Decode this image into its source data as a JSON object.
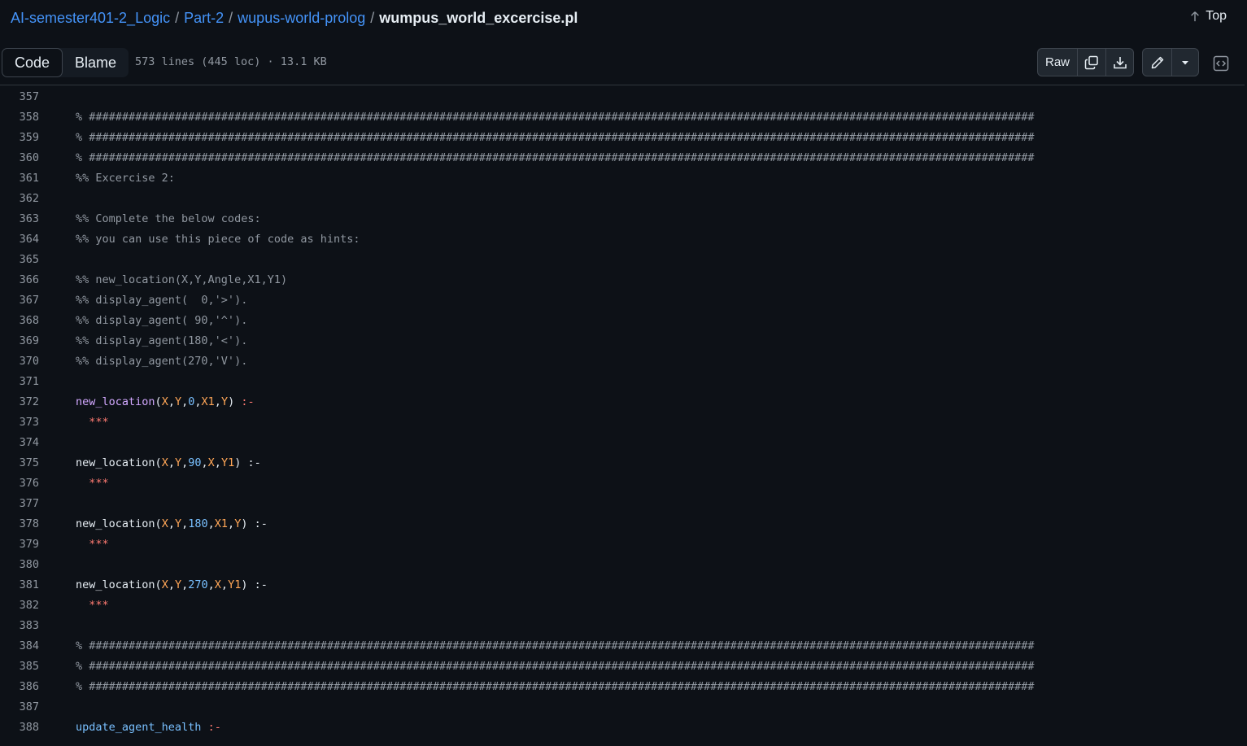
{
  "breadcrumb": {
    "repo": "AI-semester401-2_Logic",
    "folder1": "Part-2",
    "folder2": "wupus-world-prolog",
    "separator": "/",
    "file": "wumpus_world_excercise.pl"
  },
  "top_label": "Top",
  "tabs": {
    "code": "Code",
    "blame": "Blame"
  },
  "file_info": "573 lines (445 loc) · 13.1 KB",
  "toolbar": {
    "raw_label": "Raw",
    "icons": [
      "copy-icon",
      "download-icon",
      "pencil-icon",
      "triangle-down-icon",
      "code-square-icon"
    ]
  },
  "colors": {
    "background": "#0d1117",
    "link": "#4493f8",
    "comment": "#9198a1",
    "variable": "#ffa657",
    "number": "#79c0ff",
    "operator": "#ff7b72"
  },
  "lines": [
    {
      "n": "357",
      "tokens": []
    },
    {
      "n": "358",
      "tokens": [
        {
          "t": "% ###############################################################################################################################################",
          "c": "cmt"
        }
      ]
    },
    {
      "n": "359",
      "tokens": [
        {
          "t": "% ###############################################################################################################################################",
          "c": "cmt"
        }
      ]
    },
    {
      "n": "360",
      "tokens": [
        {
          "t": "% ###############################################################################################################################################",
          "c": "cmt"
        }
      ]
    },
    {
      "n": "361",
      "tokens": [
        {
          "t": "%% Excercise 2:",
          "c": "cmt"
        }
      ]
    },
    {
      "n": "362",
      "tokens": []
    },
    {
      "n": "363",
      "tokens": [
        {
          "t": "%% Complete the below codes:",
          "c": "cmt"
        }
      ]
    },
    {
      "n": "364",
      "tokens": [
        {
          "t": "%% you can use this piece of code as hints:",
          "c": "cmt"
        }
      ]
    },
    {
      "n": "365",
      "tokens": []
    },
    {
      "n": "366",
      "tokens": [
        {
          "t": "%% new_location(X,Y,Angle,X1,Y1)",
          "c": "cmt"
        }
      ]
    },
    {
      "n": "367",
      "tokens": [
        {
          "t": "%% display_agent(  0,'>').",
          "c": "cmt"
        }
      ]
    },
    {
      "n": "368",
      "tokens": [
        {
          "t": "%% display_agent( 90,'^').",
          "c": "cmt"
        }
      ]
    },
    {
      "n": "369",
      "tokens": [
        {
          "t": "%% display_agent(180,'<').",
          "c": "cmt"
        }
      ]
    },
    {
      "n": "370",
      "tokens": [
        {
          "t": "%% display_agent(270,'V').",
          "c": "cmt"
        }
      ]
    },
    {
      "n": "371",
      "tokens": []
    },
    {
      "n": "372",
      "tokens": [
        {
          "t": "new_location",
          "c": "fn"
        },
        {
          "t": "(",
          "c": "pun"
        },
        {
          "t": "X",
          "c": "var"
        },
        {
          "t": ",",
          "c": "pun"
        },
        {
          "t": "Y",
          "c": "var"
        },
        {
          "t": ",",
          "c": "pun"
        },
        {
          "t": "0",
          "c": "num"
        },
        {
          "t": ",",
          "c": "pun"
        },
        {
          "t": "X1",
          "c": "var"
        },
        {
          "t": ",",
          "c": "pun"
        },
        {
          "t": "Y",
          "c": "var"
        },
        {
          "t": ") ",
          "c": "pun"
        },
        {
          "t": ":-",
          "c": "op"
        }
      ]
    },
    {
      "n": "373",
      "tokens": [
        {
          "t": "  ***",
          "c": "op"
        }
      ]
    },
    {
      "n": "374",
      "tokens": []
    },
    {
      "n": "375",
      "tokens": [
        {
          "t": "new_location",
          "c": "fn2"
        },
        {
          "t": "(",
          "c": "pun"
        },
        {
          "t": "X",
          "c": "var"
        },
        {
          "t": ",",
          "c": "pun"
        },
        {
          "t": "Y",
          "c": "var"
        },
        {
          "t": ",",
          "c": "pun"
        },
        {
          "t": "90",
          "c": "num"
        },
        {
          "t": ",",
          "c": "pun"
        },
        {
          "t": "X",
          "c": "var"
        },
        {
          "t": ",",
          "c": "pun"
        },
        {
          "t": "Y1",
          "c": "var"
        },
        {
          "t": ") ",
          "c": "pun"
        },
        {
          "t": ":-",
          "c": "pun"
        }
      ]
    },
    {
      "n": "376",
      "tokens": [
        {
          "t": "  ***",
          "c": "op"
        }
      ]
    },
    {
      "n": "377",
      "tokens": []
    },
    {
      "n": "378",
      "tokens": [
        {
          "t": "new_location",
          "c": "fn2"
        },
        {
          "t": "(",
          "c": "pun"
        },
        {
          "t": "X",
          "c": "var"
        },
        {
          "t": ",",
          "c": "pun"
        },
        {
          "t": "Y",
          "c": "var"
        },
        {
          "t": ",",
          "c": "pun"
        },
        {
          "t": "180",
          "c": "num"
        },
        {
          "t": ",",
          "c": "pun"
        },
        {
          "t": "X1",
          "c": "var"
        },
        {
          "t": ",",
          "c": "pun"
        },
        {
          "t": "Y",
          "c": "var"
        },
        {
          "t": ") ",
          "c": "pun"
        },
        {
          "t": ":-",
          "c": "pun"
        }
      ]
    },
    {
      "n": "379",
      "tokens": [
        {
          "t": "  ***",
          "c": "op"
        }
      ]
    },
    {
      "n": "380",
      "tokens": []
    },
    {
      "n": "381",
      "tokens": [
        {
          "t": "new_location",
          "c": "fn2"
        },
        {
          "t": "(",
          "c": "pun"
        },
        {
          "t": "X",
          "c": "var"
        },
        {
          "t": ",",
          "c": "pun"
        },
        {
          "t": "Y",
          "c": "var"
        },
        {
          "t": ",",
          "c": "pun"
        },
        {
          "t": "270",
          "c": "num"
        },
        {
          "t": ",",
          "c": "pun"
        },
        {
          "t": "X",
          "c": "var"
        },
        {
          "t": ",",
          "c": "pun"
        },
        {
          "t": "Y1",
          "c": "var"
        },
        {
          "t": ") ",
          "c": "pun"
        },
        {
          "t": ":-",
          "c": "pun"
        }
      ]
    },
    {
      "n": "382",
      "tokens": [
        {
          "t": "  ***",
          "c": "op"
        }
      ]
    },
    {
      "n": "383",
      "tokens": []
    },
    {
      "n": "384",
      "tokens": [
        {
          "t": "% ###############################################################################################################################################",
          "c": "cmt"
        }
      ]
    },
    {
      "n": "385",
      "tokens": [
        {
          "t": "% ###############################################################################################################################################",
          "c": "cmt"
        }
      ]
    },
    {
      "n": "386",
      "tokens": [
        {
          "t": "% ###############################################################################################################################################",
          "c": "cmt"
        }
      ]
    },
    {
      "n": "387",
      "tokens": []
    },
    {
      "n": "388",
      "tokens": [
        {
          "t": "update_agent_health",
          "c": "kw"
        },
        {
          "t": " ",
          "c": "pun"
        },
        {
          "t": ":-",
          "c": "op"
        }
      ]
    }
  ]
}
